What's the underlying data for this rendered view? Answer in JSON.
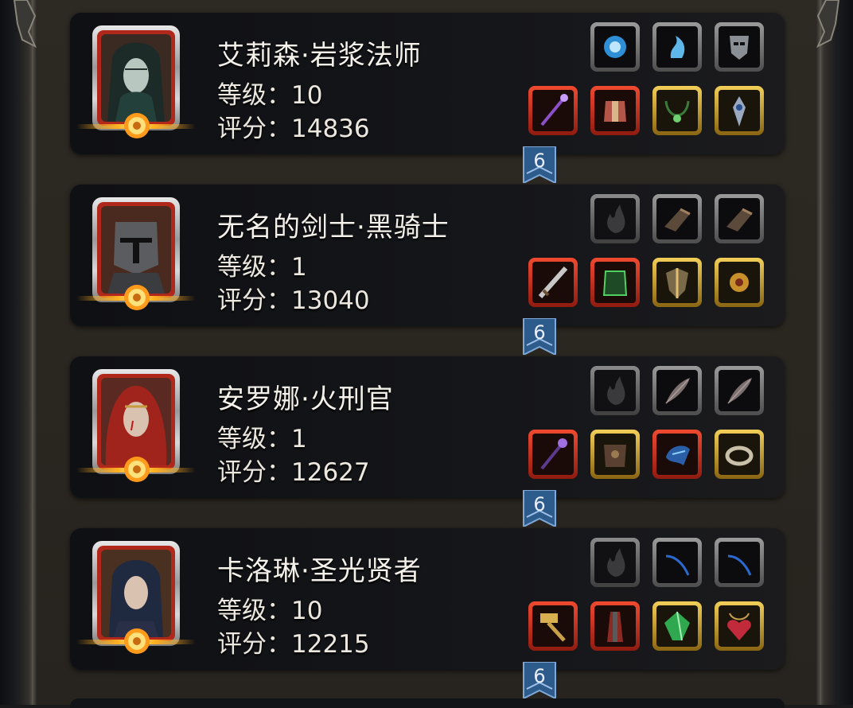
{
  "colors": {
    "panel": "#2a2620",
    "card": "#15161a",
    "slot_red": "#d63a24",
    "slot_gold": "#d4a630",
    "slot_gray": "#7a7a7a",
    "tag_blue": "#2d5c8c",
    "glow": "#ffb020"
  },
  "heroes": [
    {
      "name": "艾莉森·岩浆法师",
      "level": "等级：10",
      "score": "评分：14836",
      "tag": "6",
      "portrait_icon": "hooded-mage-woman-portrait",
      "top_slots": [
        {
          "frame": "gray",
          "icon": "blue-orb-rune-icon"
        },
        {
          "frame": "gray",
          "icon": "blue-spirit-rune-icon"
        },
        {
          "frame": "gray",
          "icon": "mask-rune-icon"
        }
      ],
      "bottom_slots": [
        {
          "frame": "red",
          "icon": "staff-icon"
        },
        {
          "frame": "red",
          "icon": "armor-icon"
        },
        {
          "frame": "gold",
          "icon": "necklace-icon"
        },
        {
          "frame": "gold",
          "icon": "amulet-icon"
        }
      ]
    },
    {
      "name": "无名的剑士·黑骑士",
      "level": "等级：1",
      "score": "评分：13040",
      "tag": "6",
      "portrait_icon": "armored-knight-helmet-portrait",
      "top_slots": [
        {
          "frame": "empty",
          "icon": "flame-placeholder-icon"
        },
        {
          "frame": "gray",
          "icon": "gauntlet-icon"
        },
        {
          "frame": "gray",
          "icon": "gauntlet-icon"
        }
      ],
      "bottom_slots": [
        {
          "frame": "red",
          "icon": "greatsword-icon"
        },
        {
          "frame": "red",
          "icon": "green-armor-icon"
        },
        {
          "frame": "gold",
          "icon": "shield-crest-icon"
        },
        {
          "frame": "gold",
          "icon": "golden-sun-amulet-icon"
        }
      ]
    },
    {
      "name": "安罗娜·火刑官",
      "level": "等级：1",
      "score": "评分：12627",
      "tag": "6",
      "portrait_icon": "red-haired-woman-portrait",
      "top_slots": [
        {
          "frame": "empty",
          "icon": "flame-placeholder-icon"
        },
        {
          "frame": "gray",
          "icon": "feather-icon"
        },
        {
          "frame": "gray",
          "icon": "feather-icon"
        }
      ],
      "bottom_slots": [
        {
          "frame": "red",
          "icon": "purple-staff-icon"
        },
        {
          "frame": "gold",
          "icon": "leather-armor-icon"
        },
        {
          "frame": "red",
          "icon": "blue-bracer-icon"
        },
        {
          "frame": "gold",
          "icon": "ring-icon"
        }
      ]
    },
    {
      "name": "卡洛琳·圣光贤者",
      "level": "等级：10",
      "score": "评分：12215",
      "tag": "6",
      "portrait_icon": "hooded-priestess-portrait",
      "top_slots": [
        {
          "frame": "empty",
          "icon": "flame-placeholder-icon"
        },
        {
          "frame": "gray",
          "icon": "blue-streak-icon"
        },
        {
          "frame": "gray",
          "icon": "blue-streak-icon"
        }
      ],
      "bottom_slots": [
        {
          "frame": "red",
          "icon": "golden-hammer-icon"
        },
        {
          "frame": "red",
          "icon": "red-robe-icon"
        },
        {
          "frame": "gold",
          "icon": "green-gem-icon"
        },
        {
          "frame": "gold",
          "icon": "heart-pendant-icon"
        }
      ]
    }
  ]
}
